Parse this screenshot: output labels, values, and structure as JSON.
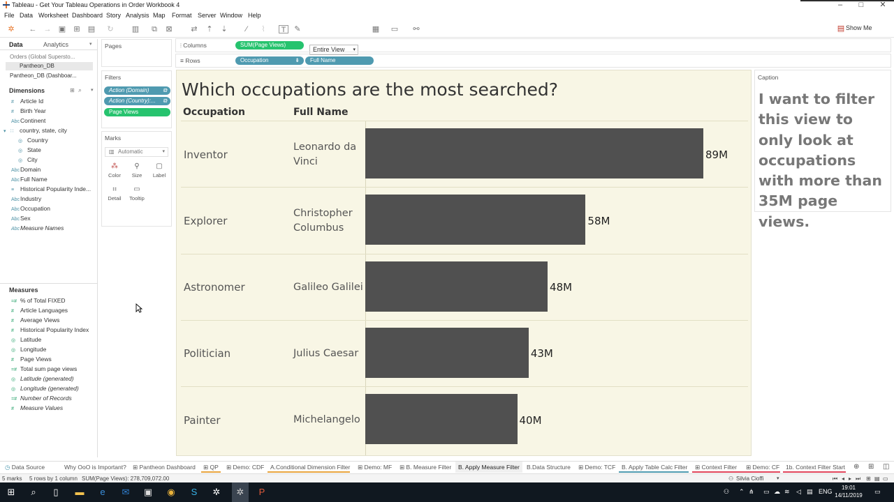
{
  "window": {
    "title": "Tableau - Get Your Tableau Operations in Order Workbook 4",
    "controls": [
      "–",
      "□",
      "✕"
    ]
  },
  "menu": [
    "File",
    "Data",
    "Worksheet",
    "Dashboard",
    "Story",
    "Analysis",
    "Map",
    "Format",
    "Server",
    "Window",
    "Help"
  ],
  "toolbar": {
    "fit": "Entire View",
    "show_me": "Show Me"
  },
  "datapane": {
    "tabs": [
      "Data",
      "Analytics"
    ],
    "datasources": [
      "Orders (Global Supersto...",
      "Pantheon_DB",
      "Pantheon_DB (Dashboar..."
    ],
    "dimensions_label": "Dimensions",
    "dimensions": [
      {
        "icon": "#",
        "label": "Article Id"
      },
      {
        "icon": "#",
        "label": "Birth Year"
      },
      {
        "icon": "Abc",
        "label": "Continent"
      },
      {
        "icon": "∷",
        "label": "country, state, city"
      },
      {
        "icon": "◎",
        "label": "Country"
      },
      {
        "icon": "◎",
        "label": "State"
      },
      {
        "icon": "◎",
        "label": "City"
      },
      {
        "icon": "Abc",
        "label": "Domain"
      },
      {
        "icon": "Abc",
        "label": "Full Name"
      },
      {
        "icon": "≡",
        "label": "Historical Popularity Inde..."
      },
      {
        "icon": "Abc",
        "label": "Industry"
      },
      {
        "icon": "Abc",
        "label": "Occupation"
      },
      {
        "icon": "Abc",
        "label": "Sex"
      },
      {
        "icon": "Abc",
        "label": "Measure Names"
      }
    ],
    "measures_label": "Measures",
    "measures": [
      {
        "icon": "=#",
        "label": "% of Total FIXED"
      },
      {
        "icon": "#",
        "label": "Article Languages"
      },
      {
        "icon": "#",
        "label": "Average Views"
      },
      {
        "icon": "#",
        "label": "Historical Popularity Index"
      },
      {
        "icon": "◎",
        "label": "Latitude"
      },
      {
        "icon": "◎",
        "label": "Longitude"
      },
      {
        "icon": "#",
        "label": "Page Views"
      },
      {
        "icon": "=#",
        "label": "Total sum page views"
      },
      {
        "icon": "◎",
        "label": "Latitude (generated)"
      },
      {
        "icon": "◎",
        "label": "Longitude (generated)"
      },
      {
        "icon": "=#",
        "label": "Number of Records"
      },
      {
        "icon": "#",
        "label": "Measure Values"
      }
    ]
  },
  "cards": {
    "pages": "Pages",
    "filters": "Filters",
    "filter_pills": [
      "Action (Domain)",
      "Action (Country):...",
      "Page Views"
    ],
    "marks": "Marks",
    "mark_type": "Automatic",
    "mark_buttons": [
      "Color",
      "Size",
      "Label",
      "Detail",
      "Tooltip"
    ]
  },
  "shelves": {
    "columns_label": "Columns",
    "columns_pill": "SUM(Page Views)",
    "rows_label": "Rows",
    "rows_pills": [
      "Occupation",
      "Full Name"
    ]
  },
  "view": {
    "title": "Which occupations are the most searched?",
    "col_headers": [
      "Occupation",
      "Full Name"
    ]
  },
  "chart_data": {
    "type": "bar",
    "orientation": "horizontal",
    "title": "Which occupations are the most searched?",
    "row_headers": [
      "Occupation",
      "Full Name"
    ],
    "rows": [
      {
        "occupation": "Inventor",
        "full_name": "Leonardo da Vinci",
        "value": 89,
        "label": "89M"
      },
      {
        "occupation": "Explorer",
        "full_name": "Christopher Columbus",
        "value": 58,
        "label": "58M"
      },
      {
        "occupation": "Astronomer",
        "full_name": "Galileo Galilei",
        "value": 48,
        "label": "48M"
      },
      {
        "occupation": "Politician",
        "full_name": "Julius Caesar",
        "value": 43,
        "label": "43M"
      },
      {
        "occupation": "Painter",
        "full_name": "Michelangelo",
        "value": 40,
        "label": "40M"
      }
    ],
    "unit": "M",
    "bar_color": "#505050",
    "xlim": [
      0,
      92
    ]
  },
  "caption": {
    "label": "Caption",
    "text": "I want to filter this view to only look at occupations with more than 35M page views."
  },
  "sheet_tabs": [
    {
      "label": "Data Source"
    },
    {
      "label": "Why OoO is Important?"
    },
    {
      "label": "Pantheon Dashboard"
    },
    {
      "label": "QP"
    },
    {
      "label": "Demo: CDF"
    },
    {
      "label": "A.Conditional Dimension Filter"
    },
    {
      "label": "Demo: MF"
    },
    {
      "label": "B. Measure Filter"
    },
    {
      "label": "B. Apply Measure Filter"
    },
    {
      "label": "B.Data Structure"
    },
    {
      "label": "Demo: TCF"
    },
    {
      "label": "B. Apply Table Calc Filter"
    },
    {
      "label": "Context Filter"
    },
    {
      "label": "Demo: CF"
    },
    {
      "label": "1b. Context Filter Start"
    }
  ],
  "status": {
    "marks": "5 marks",
    "rows": "5 rows by 1 column",
    "sum": "SUM(Page Views): 278,709,072.00",
    "user": "Silvia Cioffi"
  },
  "taskbar": {
    "lang": "ENG",
    "time": "19:01",
    "date": "14/11/2019"
  }
}
